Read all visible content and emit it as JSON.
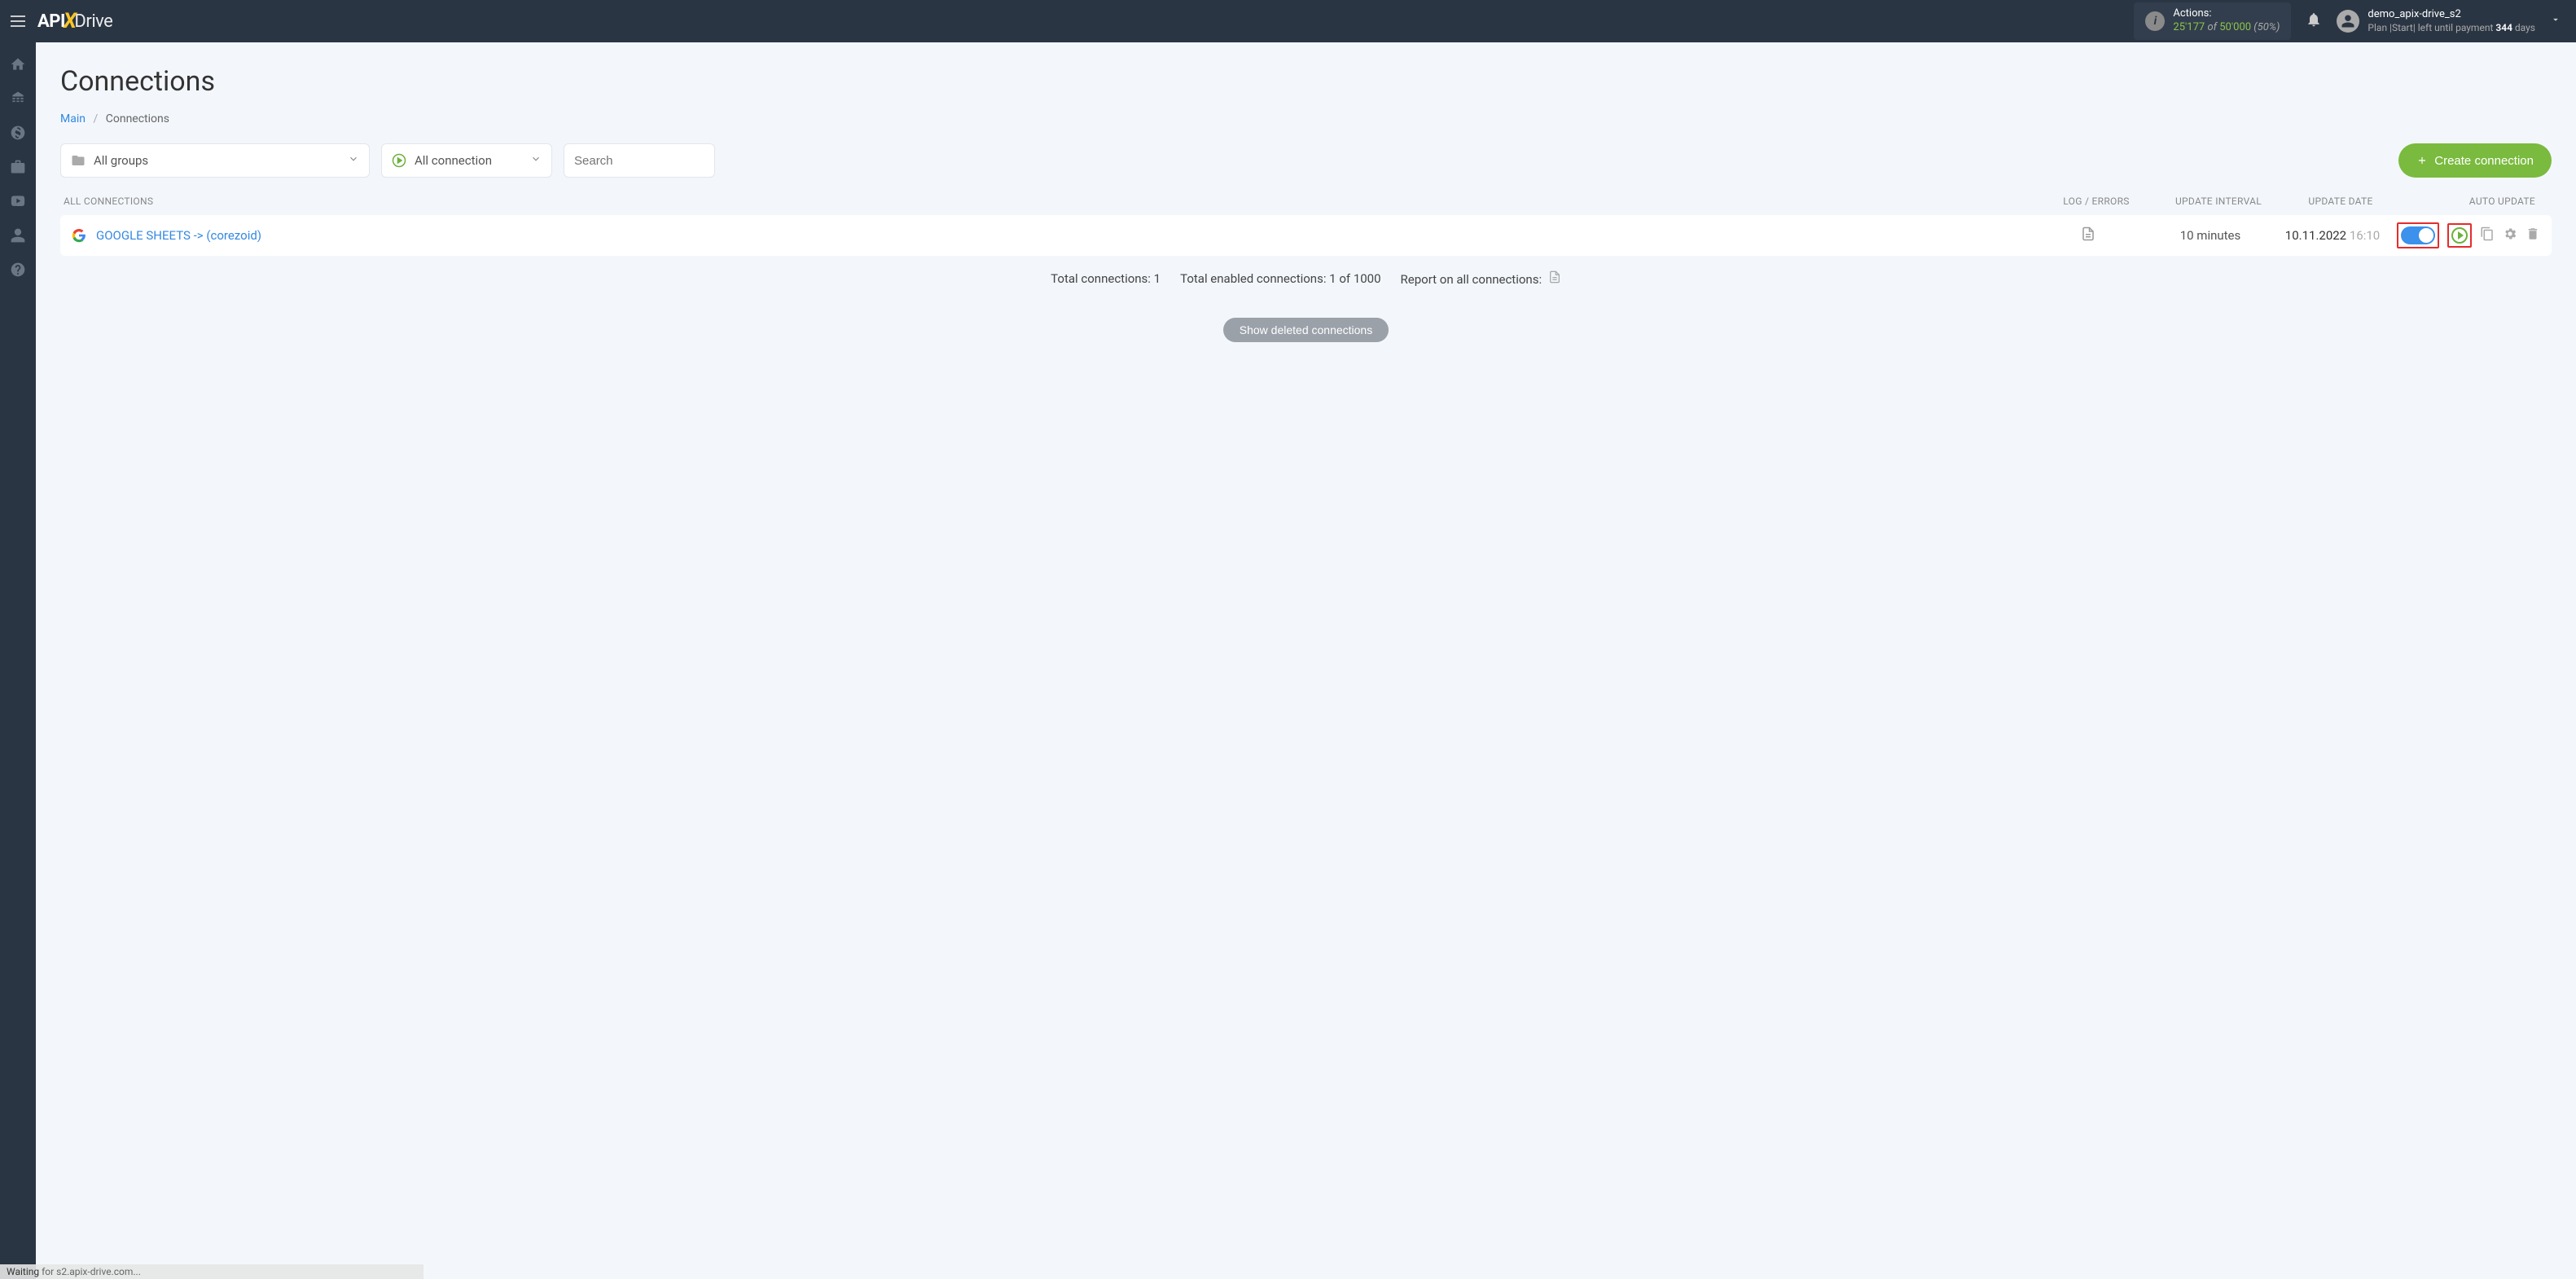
{
  "header": {
    "logo": {
      "part1": "API",
      "part2": "X",
      "part3": "Drive"
    },
    "actions": {
      "label": "Actions:",
      "used": "25'177",
      "of": "of",
      "limit": "50'000",
      "pct": "(50%)"
    },
    "user": {
      "username": "demo_apix-drive_s2",
      "plan_prefix": "Plan |Start| left until payment ",
      "days": "344",
      "days_suffix": " days"
    }
  },
  "sidebar": {
    "items": [
      "home",
      "sitemap",
      "dollar",
      "briefcase",
      "youtube",
      "user",
      "help"
    ]
  },
  "page": {
    "title": "Connections",
    "breadcrumb": {
      "main": "Main",
      "current": "Connections"
    }
  },
  "filters": {
    "groups": "All groups",
    "status": "All connection",
    "search_placeholder": "Search",
    "create_button": "Create connection"
  },
  "table": {
    "headers": {
      "name": "All connections",
      "log": "Log / Errors",
      "interval": "Update interval",
      "date": "Update date",
      "auto": "Auto update"
    },
    "rows": [
      {
        "name": "GOOGLE SHEETS -> (corezoid)",
        "interval": "10 minutes",
        "date": "10.11.2022",
        "time": "16:10"
      }
    ]
  },
  "summary": {
    "total": "Total connections: 1",
    "enabled": "Total enabled connections: 1 of 1000",
    "report": "Report on all connections:"
  },
  "show_deleted": "Show deleted connections",
  "status_bar": {
    "waiting": "Waiting",
    "rest": " for s2.apix-drive.com..."
  }
}
